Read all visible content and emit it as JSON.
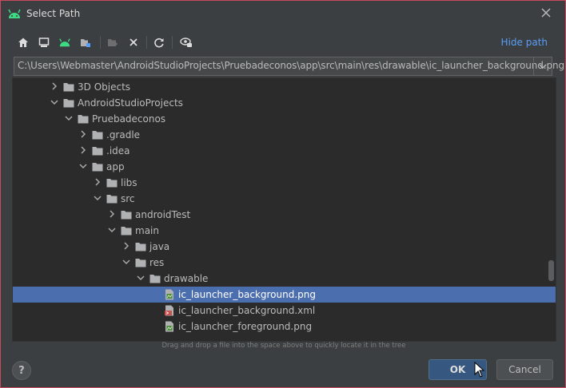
{
  "window": {
    "title": "Select Path"
  },
  "toolbar": {
    "buttons": [
      "home-icon",
      "desktop-icon",
      "android-project-icon",
      "module-folder-icon",
      "new-folder-icon",
      "delete-icon",
      "refresh-icon",
      "show-hidden-icon"
    ],
    "hide_path_label": "Hide path"
  },
  "path": {
    "value": "C:\\Users\\Webmaster\\AndroidStudioProjects\\Pruebadeconos\\app\\src\\main\\res\\drawable\\ic_launcher_background.png"
  },
  "tree": {
    "rows": [
      {
        "label": "3D Objects",
        "indent": 3,
        "chevron": "right",
        "icon": "folder"
      },
      {
        "label": "AndroidStudioProjects",
        "indent": 3,
        "chevron": "down",
        "icon": "folder"
      },
      {
        "label": "Pruebadeconos",
        "indent": 4,
        "chevron": "down",
        "icon": "folder"
      },
      {
        "label": ".gradle",
        "indent": 5,
        "chevron": "right",
        "icon": "folder"
      },
      {
        "label": ".idea",
        "indent": 5,
        "chevron": "right",
        "icon": "folder"
      },
      {
        "label": "app",
        "indent": 5,
        "chevron": "down",
        "icon": "folder"
      },
      {
        "label": "libs",
        "indent": 6,
        "chevron": "right",
        "icon": "folder"
      },
      {
        "label": "src",
        "indent": 6,
        "chevron": "down",
        "icon": "folder"
      },
      {
        "label": "androidTest",
        "indent": 7,
        "chevron": "right",
        "icon": "folder"
      },
      {
        "label": "main",
        "indent": 7,
        "chevron": "down",
        "icon": "folder"
      },
      {
        "label": "java",
        "indent": 8,
        "chevron": "right",
        "icon": "folder"
      },
      {
        "label": "res",
        "indent": 8,
        "chevron": "down",
        "icon": "folder"
      },
      {
        "label": "drawable",
        "indent": 9,
        "chevron": "down",
        "icon": "folder"
      },
      {
        "label": "ic_launcher_background.png",
        "indent": 10,
        "chevron": "none",
        "icon": "png-file",
        "selected": true
      },
      {
        "label": "ic_launcher_background.xml",
        "indent": 10,
        "chevron": "none",
        "icon": "xml-file"
      },
      {
        "label": "ic_launcher_foreground.png",
        "indent": 10,
        "chevron": "none",
        "icon": "png-file"
      }
    ],
    "hint": "Drag and drop a file into the space above to quickly locate it in the tree"
  },
  "footer": {
    "help_label": "?",
    "ok_label": "OK",
    "cancel_label": "Cancel"
  },
  "colors": {
    "selection": "#4b6eaf",
    "link": "#589df6",
    "android_green": "#3ddc84",
    "background": "#3c3f41",
    "tree_background": "#2b2b2b"
  }
}
